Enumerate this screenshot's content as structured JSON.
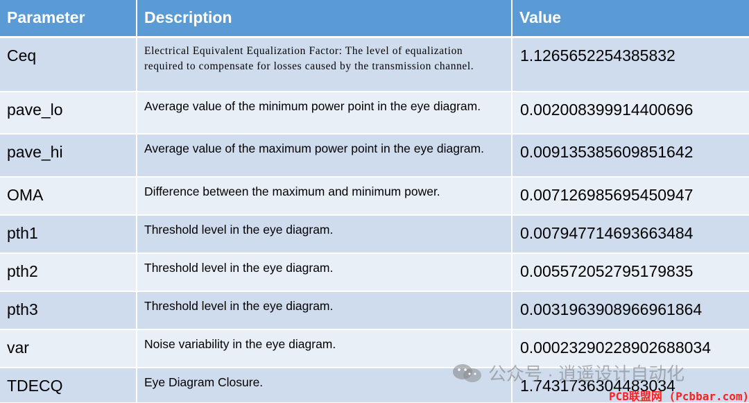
{
  "table": {
    "headers": [
      "Parameter",
      "Description",
      "Value"
    ],
    "rows": [
      {
        "parameter": "Ceq",
        "description": "Electrical Equivalent Equalization Factor: The level of equalization required to compensate for losses caused by the transmission channel.",
        "value": "1.1265652254385832"
      },
      {
        "parameter": "pave_lo",
        "description": "Average value of the minimum power point in the eye diagram.",
        "value": "0.002008399914400696"
      },
      {
        "parameter": "pave_hi",
        "description": "Average value of the maximum power point in the eye diagram.",
        "value": "0.009135385609851642"
      },
      {
        "parameter": "OMA",
        "description": "Difference between the maximum and minimum power.",
        "value": "0.007126985695450947"
      },
      {
        "parameter": "pth1",
        "description": "Threshold level in the eye diagram.",
        "value": "0.007947714693663484"
      },
      {
        "parameter": "pth2",
        "description": "Threshold level in the eye diagram.",
        "value": "0.005572052795179835"
      },
      {
        "parameter": "pth3",
        "description": "Threshold level in the eye diagram.",
        "value": "0.0031963908966961864"
      },
      {
        "parameter": "var",
        "description": "Noise variability in the eye diagram.",
        "value": "0.00023290228902688034"
      },
      {
        "parameter": "TDECQ",
        "description": "Eye Diagram Closure.",
        "value": "1.7431736304483034"
      }
    ]
  },
  "watermark": {
    "icon": "wechat-icon",
    "text": "公众号 · 逍遥设计自动化"
  },
  "site_mark": "PCB联盟网 (Pcbbar.com)",
  "colors": {
    "header_bg": "#5b9bd5",
    "row_even": "#cfdcee",
    "row_odd": "#e9eff7",
    "site_mark": "#ff1f1f"
  }
}
